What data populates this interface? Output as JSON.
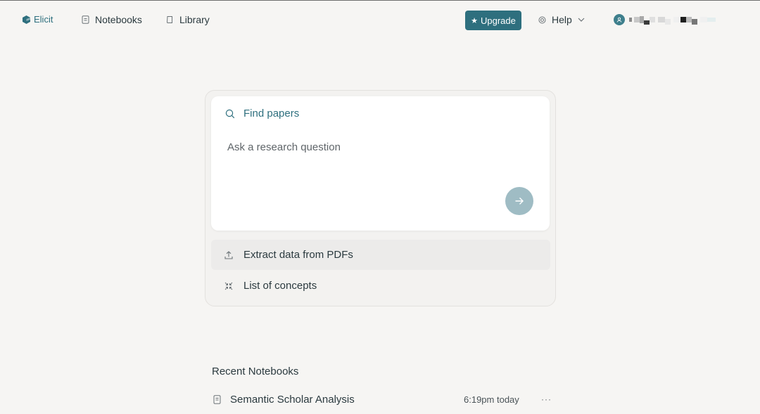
{
  "nav": {
    "logo_label": "Elicit",
    "notebooks_label": "Notebooks",
    "library_label": "Library",
    "upgrade_label": "Upgrade",
    "help_label": "Help"
  },
  "search": {
    "mode_label": "Find papers",
    "placeholder": "Ask a research question"
  },
  "options": [
    {
      "label": "Extract data from PDFs",
      "icon": "upload-icon"
    },
    {
      "label": "List of concepts",
      "icon": "collapse-icon"
    }
  ],
  "recent": {
    "title": "Recent Notebooks",
    "items": [
      {
        "title": "Semantic Scholar Analysis",
        "time": "6:19pm today"
      }
    ]
  },
  "colors": {
    "accent": "#2e6f7e",
    "submit_disabled": "#9fbcc4",
    "background": "#f6f5f3"
  }
}
